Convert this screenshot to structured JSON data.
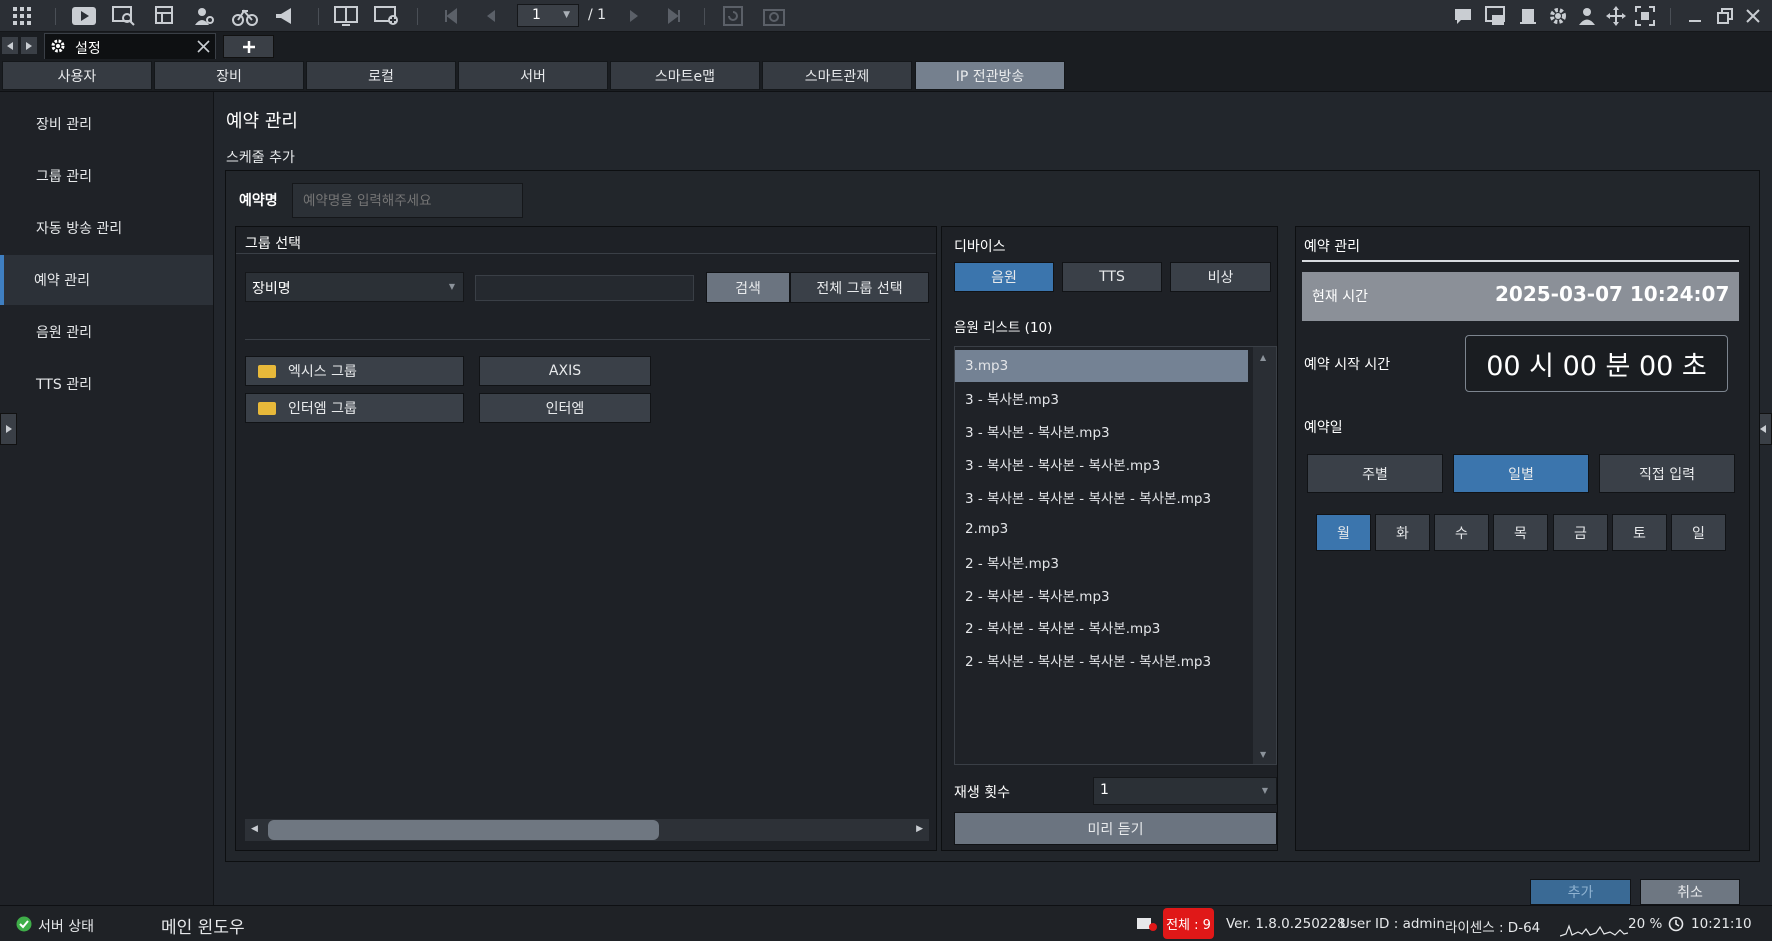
{
  "toolbar": {
    "page_current": "1",
    "page_total": "/ 1",
    "icons": [
      "grid-icon",
      "play-icon",
      "video-search-icon",
      "layout-icon",
      "person-search-icon",
      "bike-icon",
      "megaphone-icon",
      "monitor-layout-icon",
      "monitor-add-icon",
      "first-page-icon",
      "prev-page-icon",
      "next-page-icon",
      "last-page-icon",
      "refresh-icon",
      "camera-icon",
      "chat-icon",
      "message-icon",
      "badge-icon",
      "gear-icon",
      "user-icon",
      "move-icon",
      "fullscreen-icon",
      "minimize-icon",
      "restore-icon",
      "close-icon"
    ]
  },
  "doc_tab": {
    "label": "설정"
  },
  "nav_tabs": [
    "사용자",
    "장비",
    "로컬",
    "서버",
    "스마트e맵",
    "스마트관제",
    "IP 전관방송"
  ],
  "sidebar": {
    "items": [
      "장비 관리",
      "그룹 관리",
      "자동 방송 관리",
      "예약 관리",
      "음원 관리",
      "TTS 관리"
    ]
  },
  "main": {
    "title": "예약 관리",
    "section": "스케줄 추가",
    "name_label": "예약명",
    "name_placeholder": "예약명을 입력해주세요"
  },
  "group_panel": {
    "title": "그룹 선택",
    "dropdown_value": "장비명",
    "search_button": "검색",
    "select_all_button": "전체 그룹 선택",
    "groups": [
      {
        "name": "엑시스 그룹",
        "tag": "AXIS"
      },
      {
        "name": "인터엠 그룹",
        "tag": "인터엠"
      }
    ]
  },
  "device_panel": {
    "title": "디바이스",
    "buttons": [
      "음원",
      "TTS",
      "비상"
    ],
    "list_title": "음원 리스트 (10)",
    "files": [
      "3.mp3",
      "3 - 복사본.mp3",
      "3 - 복사본 - 복사본.mp3",
      "3 - 복사본 - 복사본 - 복사본.mp3",
      "3 - 복사본 - 복사본 - 복사본 - 복사본.mp3",
      "2.mp3",
      "2 - 복사본.mp3",
      "2 - 복사본 - 복사본.mp3",
      "2 - 복사본 - 복사본 - 복사본.mp3",
      "2 - 복사본 - 복사본 - 복사본 - 복사본.mp3"
    ],
    "play_count_label": "재생 횟수",
    "play_count_value": "1",
    "preview_button": "미리 듣기"
  },
  "schedule_panel": {
    "title": "예약 관리",
    "current_time_label": "현재 시간",
    "current_time": "2025-03-07 10:24:07",
    "start_time_label": "예약 시작 시간",
    "start_time": "00 시 00 분 00 초",
    "date_label": "예약일",
    "modes": [
      "주별",
      "일별",
      "직접 입력"
    ],
    "days": [
      "월",
      "화",
      "수",
      "목",
      "금",
      "토",
      "일"
    ]
  },
  "actions": {
    "add": "추가",
    "cancel": "취소"
  },
  "statusbar": {
    "server_status": "서버 상태",
    "main_window": "메인 윈도우",
    "alert": "전체 : 9",
    "version": "Ver. 1.8.0.250228",
    "user": "User ID : admin",
    "license": "라이센스 : D-64",
    "cpu": "20 %",
    "clock": "10:21:10"
  },
  "colors": {
    "accent_blue": "#3b75ad",
    "active_tab": "#75808e",
    "alert_red": "#e01818",
    "ok_green": "#3fae49"
  }
}
